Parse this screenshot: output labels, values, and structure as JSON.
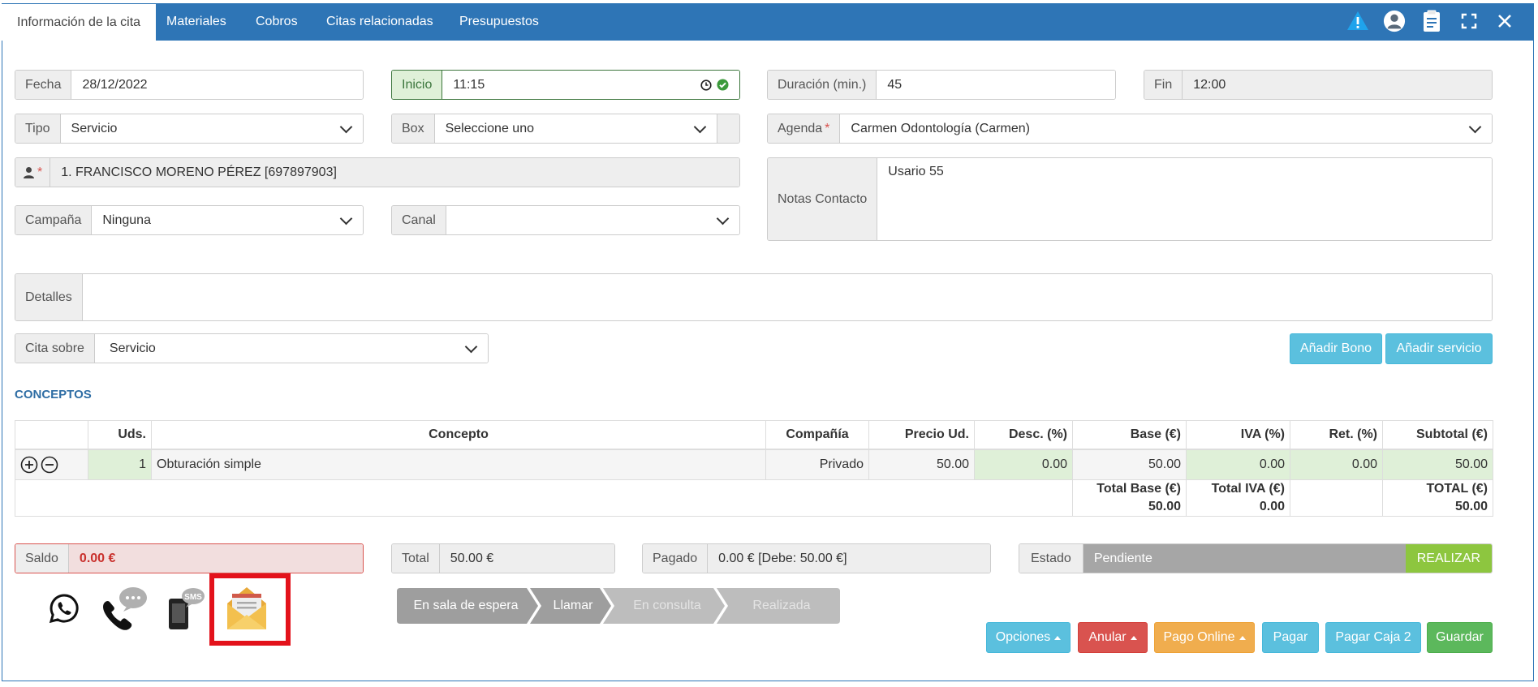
{
  "tabs": [
    {
      "label": "Información de la cita"
    },
    {
      "label": "Materiales"
    },
    {
      "label": "Cobros"
    },
    {
      "label": "Citas relacionadas"
    },
    {
      "label": "Presupuestos"
    }
  ],
  "form": {
    "fecha": {
      "label": "Fecha",
      "value": "28/12/2022"
    },
    "inicio": {
      "label": "Inicio",
      "value": "11:15"
    },
    "duracion": {
      "label": "Duración (min.)",
      "value": "45"
    },
    "fin": {
      "label": "Fin",
      "value": "12:00"
    },
    "tipo": {
      "label": "Tipo",
      "value": "Servicio"
    },
    "box": {
      "label": "Box",
      "value": "Seleccione uno"
    },
    "agenda": {
      "label": "Agenda",
      "value": "Carmen Odontología (Carmen)"
    },
    "paciente": {
      "value": "1. FRANCISCO MORENO PÉREZ [697897903]"
    },
    "notas": {
      "label": "Notas Contacto",
      "value": "Usario 55"
    },
    "campana": {
      "label": "Campaña",
      "value": "Ninguna"
    },
    "canal": {
      "label": "Canal",
      "value": ""
    },
    "detalles": {
      "label": "Detalles",
      "value": ""
    },
    "cita_sobre": {
      "label": "Cita sobre",
      "value": "Servicio"
    },
    "required_mark": "*"
  },
  "buttons": {
    "anadir_bono": "Añadir Bono",
    "anadir_servicio": "Añadir servicio",
    "realizar": "REALIZAR",
    "opciones": "Opciones",
    "anular": "Anular",
    "pago_online": "Pago Online",
    "pagar": "Pagar",
    "pagar_caja2": "Pagar Caja 2",
    "guardar": "Guardar"
  },
  "conceptos": {
    "title": "CONCEPTOS",
    "headers": [
      "Uds.",
      "Concepto",
      "Compañía",
      "Precio Ud.",
      "Desc. (%)",
      "Base (€)",
      "IVA (%)",
      "Ret. (%)",
      "Subtotal (€)"
    ],
    "row": {
      "uds": "1",
      "concepto": "Obturación simple",
      "compania": "Privado",
      "precio": "50.00",
      "desc": "0.00",
      "base": "50.00",
      "iva": "0.00",
      "ret": "0.00",
      "subtotal": "50.00"
    },
    "totals": {
      "base_label": "Total Base (€)",
      "base_value": "50.00",
      "iva_label": "Total IVA (€)",
      "iva_value": "0.00",
      "total_label": "TOTAL (€)",
      "total_value": "50.00"
    }
  },
  "summary": {
    "saldo_label": "Saldo",
    "saldo_value": "0.00 €",
    "total_label": "Total",
    "total_value": "50.00 €",
    "pagado_label": "Pagado",
    "pagado_value": "0.00 € [Debe: 50.00 €]",
    "estado_label": "Estado",
    "estado_value": "Pendiente"
  },
  "steps": [
    "En sala de espera",
    "Llamar",
    "En consulta",
    "Realizada"
  ],
  "contact_icons": {
    "sms_badge": "SMS",
    "names": [
      "whatsapp-icon",
      "phone-call-icon",
      "sms-icon",
      "email-icon"
    ]
  },
  "colors": {
    "header_blue": "#2e75b6",
    "info": "#5bc0de",
    "danger": "#d9534f",
    "warning": "#f0ad4e",
    "success": "#5cb85c",
    "estado_bar": "#a6a6a6",
    "realizar": "#8dc63f",
    "highlight_box": "#e3121b"
  }
}
